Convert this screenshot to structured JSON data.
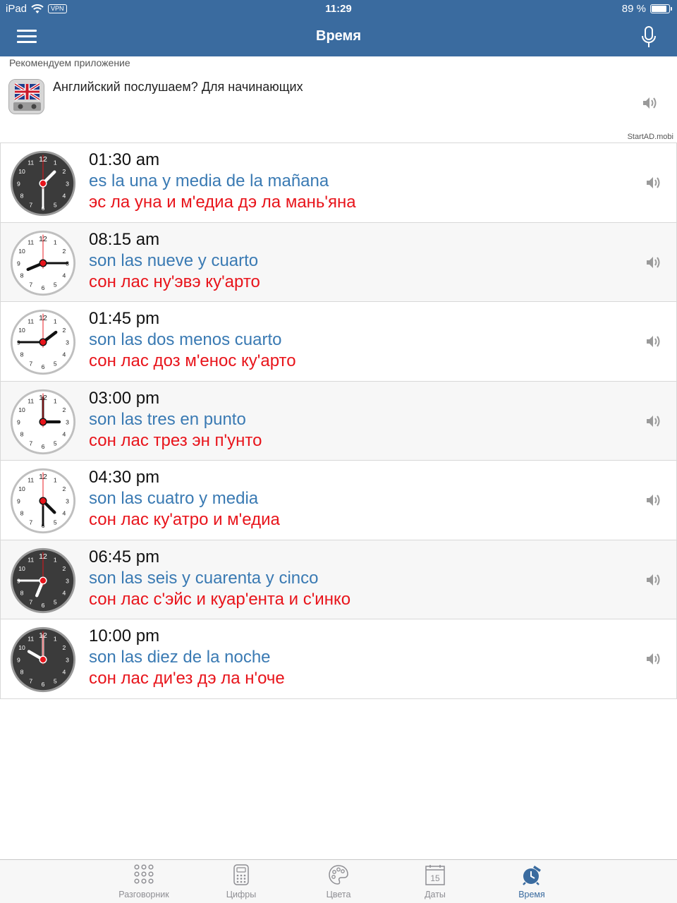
{
  "status_bar": {
    "device": "iPad",
    "vpn": "VPN",
    "time": "11:29",
    "battery_text": "89 %",
    "battery_level": 0.89
  },
  "nav": {
    "title": "Время"
  },
  "ad": {
    "label": "Рекомендуем приложение",
    "app_title": "Английский послушаем? Для начинающих",
    "source": "StartAD.mobi"
  },
  "rows": [
    {
      "time": "01:30 am",
      "es": "es la una y media de la mañana",
      "ru": "эс ла уна и м'едиа дэ ла мань'яна",
      "hour": 1,
      "minute": 30,
      "dark": true
    },
    {
      "time": "08:15 am",
      "es": "son las nueve y cuarto",
      "ru": "сон лас ну'эвэ ку'арто",
      "hour": 8,
      "minute": 15,
      "dark": false
    },
    {
      "time": "01:45 pm",
      "es": "son las dos menos cuarto",
      "ru": "сон лас доз м'енос ку'арто",
      "hour": 13,
      "minute": 45,
      "dark": false
    },
    {
      "time": "03:00 pm",
      "es": "son las tres en punto",
      "ru": "сон лас трез эн п'унто",
      "hour": 15,
      "minute": 0,
      "dark": false
    },
    {
      "time": "04:30 pm",
      "es": "son las cuatro y media",
      "ru": "сон лас ку'атро и м'едиа",
      "hour": 16,
      "minute": 30,
      "dark": false
    },
    {
      "time": "06:45 pm",
      "es": "son las seis y cuarenta y cinco",
      "ru": "сон лас с'эйс и куар'ента и с'инко",
      "hour": 18,
      "minute": 45,
      "dark": true
    },
    {
      "time": "10:00 pm",
      "es": "son las diez de la noche",
      "ru": "сон лас ди'ез дэ ла н'оче",
      "hour": 22,
      "minute": 0,
      "dark": true
    }
  ],
  "tabs": [
    {
      "label": "Разговорник",
      "icon": "phrasebook-grid-icon"
    },
    {
      "label": "Цифры",
      "icon": "numbers-calculator-icon"
    },
    {
      "label": "Цвета",
      "icon": "colors-palette-icon"
    },
    {
      "label": "Даты",
      "icon": "dates-calendar-icon",
      "calendar_day": "15"
    },
    {
      "label": "Время",
      "icon": "time-alarm-icon",
      "active": true
    }
  ],
  "colors": {
    "header": "#3a6b9f",
    "spanish_text": "#3a7ab3",
    "russian_text": "#e8141b",
    "clock_hand_accent": "#e8141b"
  }
}
